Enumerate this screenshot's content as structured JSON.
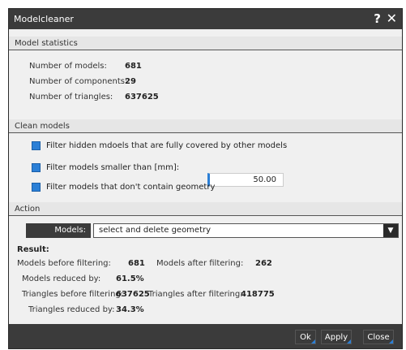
{
  "window": {
    "title": "Modelcleaner",
    "help_glyph": "?",
    "close_glyph": "✕"
  },
  "model_statistics": {
    "header": "Model statistics",
    "rows": [
      {
        "label": "Number of models:",
        "value": "681"
      },
      {
        "label": "Number of components:",
        "value": "29"
      },
      {
        "label": "Number of triangles:",
        "value": "637625"
      }
    ]
  },
  "clean_models": {
    "header": "Clean models",
    "options": [
      {
        "label": "Filter hidden mdoels that are fully covered by other models",
        "checked": true
      },
      {
        "label": "Filter models smaller than [mm]:",
        "checked": true
      },
      {
        "label": "Filter models that don't contain geometry",
        "checked": true
      }
    ],
    "size_value": "50.00"
  },
  "action": {
    "header": "Action",
    "models_label": "Models:",
    "selected": "select and delete geometry",
    "arrow_glyph": "▼"
  },
  "result": {
    "title": "Result:",
    "models_before_label": "Models before filtering:",
    "models_before": "681",
    "models_after_label": "Models after filtering:",
    "models_after": "262",
    "models_reduced_label": "Models reduced by:",
    "models_reduced": "61.5%",
    "tris_before_label": "Triangles before filtering:",
    "tris_before": "637625",
    "tris_after_label": "Triangles after filtering:",
    "tris_after": "418775",
    "tris_reduced_label": "Triangles reduced by:",
    "tris_reduced": "34.3%"
  },
  "buttons": {
    "ok": "Ok",
    "apply": "Apply",
    "close": "Close"
  },
  "colors": {
    "accent": "#2b7fd6",
    "titlebar": "#3b3b3b"
  }
}
